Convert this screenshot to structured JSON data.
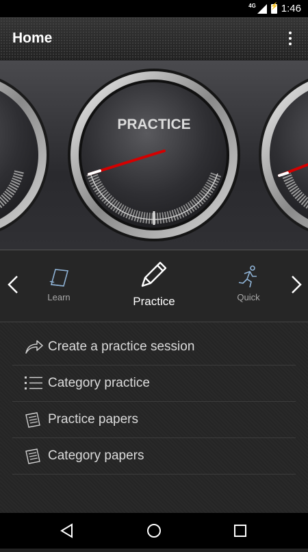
{
  "status_bar": {
    "network": "4G",
    "time": "1:46"
  },
  "action_bar": {
    "title": "Home",
    "menu_icon": "overflow-menu-icon"
  },
  "gauge": {
    "label": "PRACTICE",
    "needle_color": "#d40000"
  },
  "modes": {
    "left": {
      "label": "Learn",
      "icon": "book-icon"
    },
    "center": {
      "label": "Practice",
      "icon": "pencil-icon"
    },
    "right": {
      "label": "Quick",
      "icon": "running-person-icon"
    }
  },
  "menu_items": [
    {
      "label": "Create a practice session",
      "icon": "share-arrow-icon"
    },
    {
      "label": "Category practice",
      "icon": "list-icon"
    },
    {
      "label": "Practice papers",
      "icon": "papers-icon"
    },
    {
      "label": "Category papers",
      "icon": "papers-icon"
    }
  ],
  "nav_bar": {
    "back": "back-icon",
    "home": "home-icon",
    "recents": "recents-icon"
  }
}
